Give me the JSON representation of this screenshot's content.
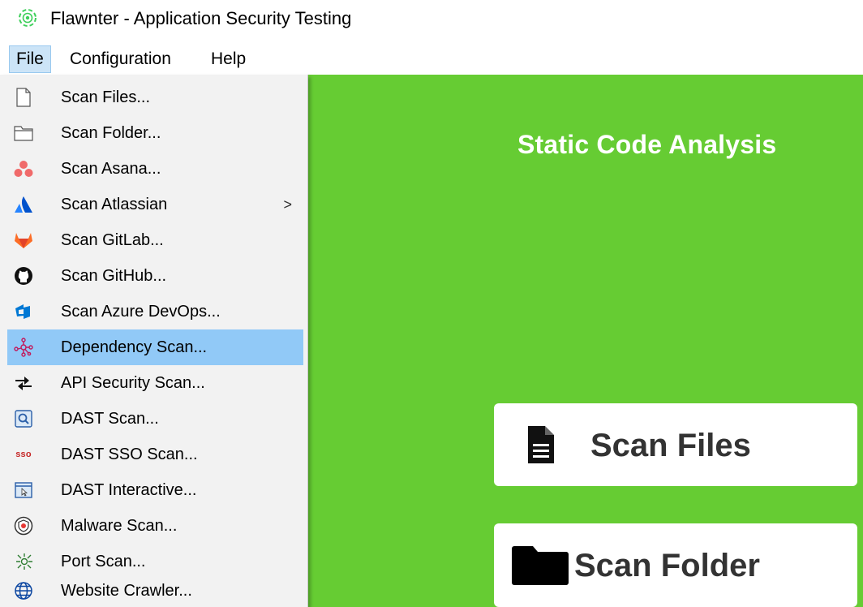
{
  "window": {
    "title": "Flawnter - Application Security Testing",
    "icon": "radar-target-icon"
  },
  "menubar": {
    "items": [
      "File",
      "Configuration",
      "Help"
    ],
    "active": "File"
  },
  "file_menu": {
    "highlighted": "Dependency Scan...",
    "items": [
      {
        "label": "Scan Files...",
        "icon": "file-icon"
      },
      {
        "label": "Scan Folder...",
        "icon": "folder-icon"
      },
      {
        "label": "Scan Asana...",
        "icon": "asana-icon"
      },
      {
        "label": "Scan Atlassian",
        "icon": "atlassian-icon",
        "submenu_arrow": ">"
      },
      {
        "label": "Scan GitLab...",
        "icon": "gitlab-icon"
      },
      {
        "label": "Scan GitHub...",
        "icon": "github-icon"
      },
      {
        "label": "Scan Azure DevOps...",
        "icon": "azure-devops-icon"
      },
      {
        "label": "Dependency Scan...",
        "icon": "dependency-graph-icon"
      },
      {
        "label": "API Security Scan...",
        "icon": "api-arrows-icon"
      },
      {
        "label": "DAST Scan...",
        "icon": "dast-scan-icon"
      },
      {
        "label": "DAST SSO Scan...",
        "icon": "sso-icon",
        "icon_text": "sso"
      },
      {
        "label": "DAST Interactive...",
        "icon": "interactive-browser-icon"
      },
      {
        "label": "Malware Scan...",
        "icon": "malware-shield-icon"
      },
      {
        "label": "Port Scan...",
        "icon": "port-scan-icon"
      },
      {
        "label": "Website Crawler...",
        "icon": "globe-icon"
      }
    ]
  },
  "main": {
    "section_title": "Static Code Analysis",
    "buttons": {
      "scan_files": {
        "label": "Scan Files",
        "icon": "file-icon"
      },
      "scan_folder": {
        "label": "Scan Folder",
        "icon": "folder-icon"
      }
    }
  },
  "colors": {
    "panel_green": "#66cc33",
    "menu_bg": "#f2f2f2",
    "menu_highlight": "#91c9f7",
    "menubar_active": "#cce4f7"
  }
}
